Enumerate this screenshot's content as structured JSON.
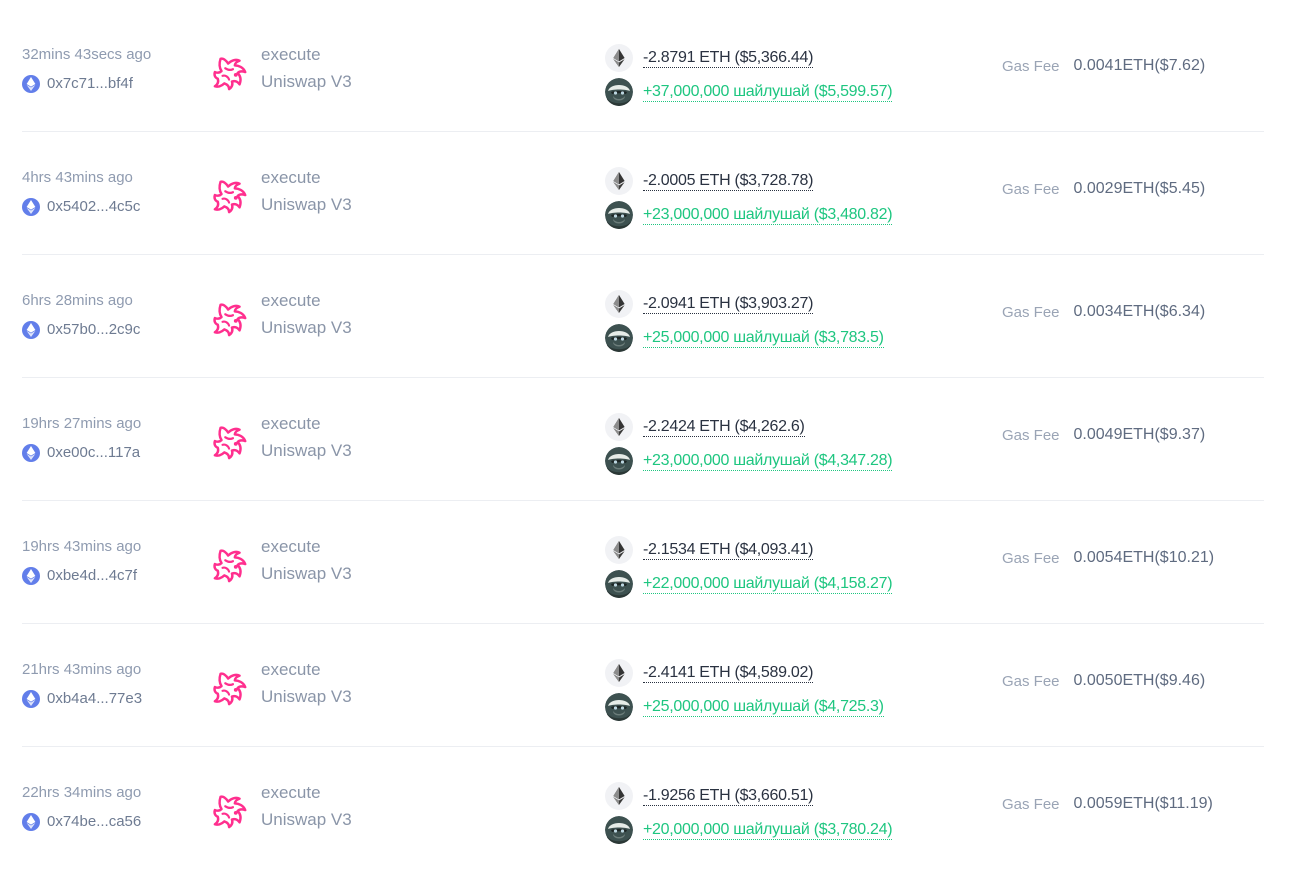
{
  "colors": {
    "accent_positive": "#1ec680",
    "text_dark": "#2a3241",
    "text_muted": "#8f9bb0",
    "eth_blue": "#627eea",
    "uniswap_pink": "#ff007a"
  },
  "icons": {
    "chain": "ethereum-chain-icon",
    "method": "uniswap-logo-icon",
    "token_out": "eth-token-icon",
    "token_in": "meme-token-avatar-icon"
  },
  "gas_label": "Gas Fee",
  "transactions": [
    {
      "time": "32mins 43secs ago",
      "hash": "0x7c71...bf4f",
      "method": "execute",
      "protocol": "Uniswap V3",
      "out": "-2.8791 ETH ($5,366.44)",
      "in": "+37,000,000 шайлушай ($5,599.57)",
      "gas": "0.0041ETH($7.62)"
    },
    {
      "time": "4hrs 43mins ago",
      "hash": "0x5402...4c5c",
      "method": "execute",
      "protocol": "Uniswap V3",
      "out": "-2.0005 ETH ($3,728.78)",
      "in": "+23,000,000 шайлушай ($3,480.82)",
      "gas": "0.0029ETH($5.45)"
    },
    {
      "time": "6hrs 28mins ago",
      "hash": "0x57b0...2c9c",
      "method": "execute",
      "protocol": "Uniswap V3",
      "out": "-2.0941 ETH ($3,903.27)",
      "in": "+25,000,000 шайлушай ($3,783.5)",
      "gas": "0.0034ETH($6.34)"
    },
    {
      "time": "19hrs 27mins ago",
      "hash": "0xe00c...117a",
      "method": "execute",
      "protocol": "Uniswap V3",
      "out": "-2.2424 ETH ($4,262.6)",
      "in": "+23,000,000 шайлушай ($4,347.28)",
      "gas": "0.0049ETH($9.37)"
    },
    {
      "time": "19hrs 43mins ago",
      "hash": "0xbe4d...4c7f",
      "method": "execute",
      "protocol": "Uniswap V3",
      "out": "-2.1534 ETH ($4,093.41)",
      "in": "+22,000,000 шайлушай ($4,158.27)",
      "gas": "0.0054ETH($10.21)"
    },
    {
      "time": "21hrs 43mins ago",
      "hash": "0xb4a4...77e3",
      "method": "execute",
      "protocol": "Uniswap V3",
      "out": "-2.4141 ETH ($4,589.02)",
      "in": "+25,000,000 шайлушай ($4,725.3)",
      "gas": "0.0050ETH($9.46)"
    },
    {
      "time": "22hrs 34mins ago",
      "hash": "0x74be...ca56",
      "method": "execute",
      "protocol": "Uniswap V3",
      "out": "-1.9256 ETH ($3,660.51)",
      "in": "+20,000,000 шайлушай ($3,780.24)",
      "gas": "0.0059ETH($11.19)"
    }
  ]
}
